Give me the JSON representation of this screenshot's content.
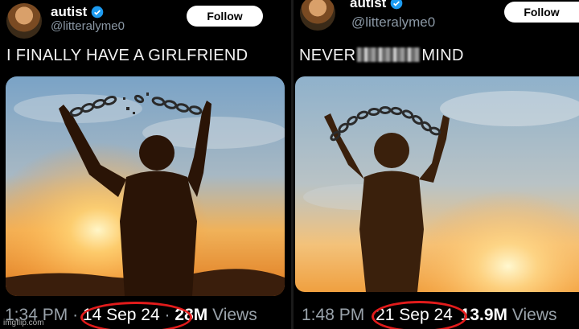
{
  "watermark": "imgflip.com",
  "left": {
    "user": {
      "name": "autist",
      "handle": "@litteralyme0"
    },
    "follow_label": "Follow",
    "tweet_text": "I FINALLY HAVE A GIRLFRIEND",
    "time": "1:34 PM",
    "sep": "·",
    "date": "14 Sep 24",
    "sep2": "·",
    "views_count": "28M",
    "views_label": "Views"
  },
  "right": {
    "user": {
      "name": "autist",
      "handle": "@litteralyme0"
    },
    "follow_label": "Follow",
    "tweet_text_before": "NEVER",
    "tweet_text_after": "MIND",
    "time": "1:48 PM",
    "date": "21 Sep 24",
    "views_count": "13.9M",
    "views_label": "Views"
  },
  "colors": {
    "verified": "#1d9bf0",
    "highlight_circle": "#e21b1b",
    "background": "#000000"
  }
}
